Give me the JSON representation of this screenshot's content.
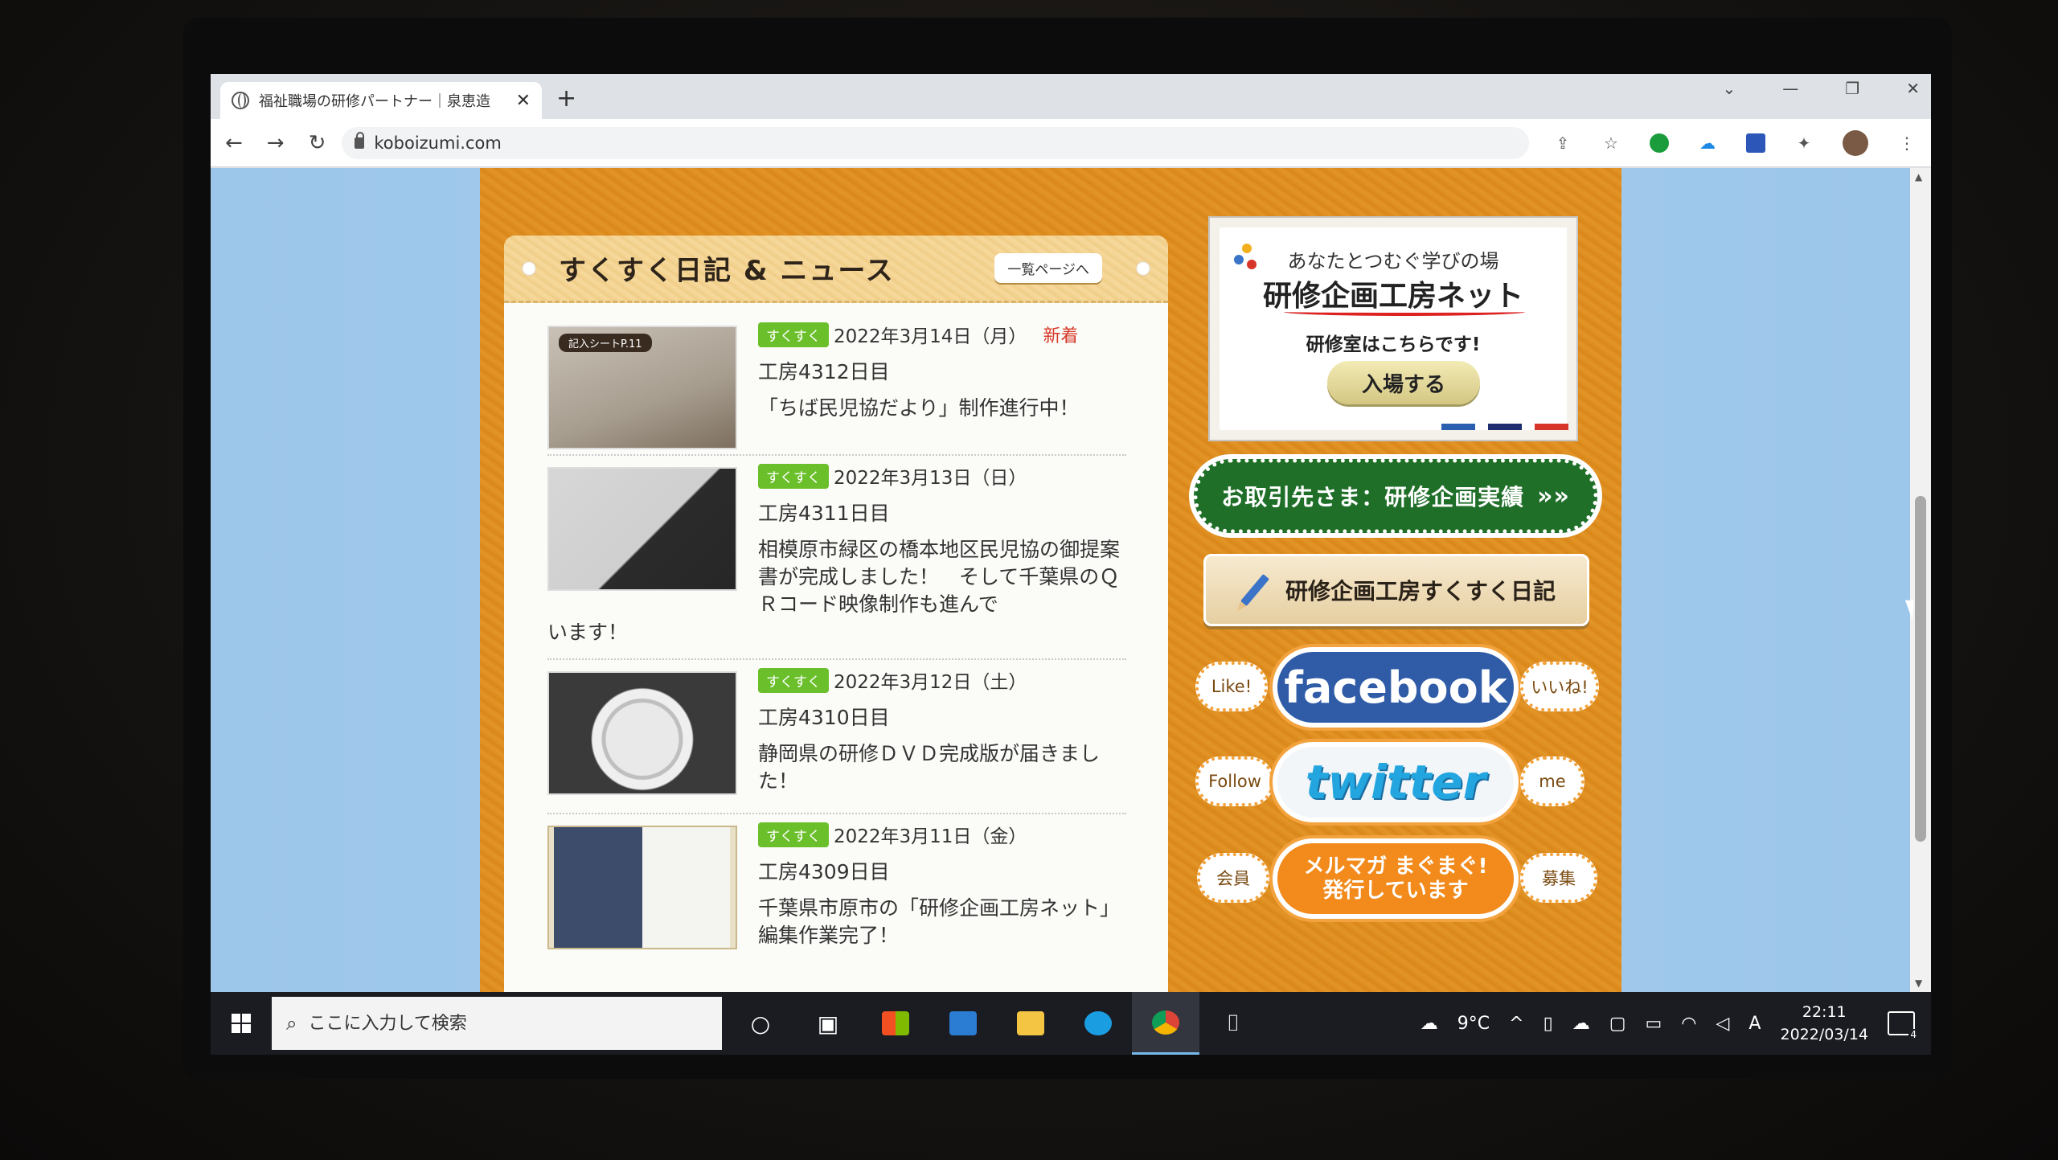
{
  "browser": {
    "tab_title": "福祉職場の研修パートナー｜泉恵造",
    "tab_close": "✕",
    "new_tab": "+",
    "url": "koboizumi.com",
    "window_controls": [
      "⌄",
      "—",
      "❐",
      "✕"
    ]
  },
  "news": {
    "title": "すくすく日記 & ニュース",
    "more_button": "一覧ページへ",
    "thumb_tag": "記入シートP.11",
    "items": [
      {
        "badge": "すくすく",
        "date": "2022年3月14日（月）",
        "new_label": "新着",
        "count": "工房4312日目",
        "desc": "「ちば民児協だより」制作進行中！",
        "desc_overflow": ""
      },
      {
        "badge": "すくすく",
        "date": "2022年3月13日（日）",
        "new_label": "",
        "count": "工房4311日目",
        "desc": "相模原市緑区の橋本地区民児協の御提案書が完成しました！　そして千葉県のＱＲコード映像制作も進んで",
        "desc_overflow": "います！"
      },
      {
        "badge": "すくすく",
        "date": "2022年3月12日（土）",
        "new_label": "",
        "count": "工房4310日目",
        "desc": "静岡県の研修ＤＶＤ完成版が届きました！",
        "desc_overflow": ""
      },
      {
        "badge": "すくすく",
        "date": "2022年3月11日（金）",
        "new_label": "",
        "count": "工房4309日目",
        "desc": "千葉県市原市の「研修企画工房ネット」編集作業完了！",
        "desc_overflow": ""
      }
    ]
  },
  "sidebar": {
    "banner": {
      "subtitle": "あなたとつむぐ学びの場",
      "title": "研修企画工房ネット",
      "room_text": "研修室はこちらです!",
      "enter_button": "入場する"
    },
    "clients_button": "お取引先さま：研修企画実績",
    "clients_arrows": "»»",
    "diary_button": "研修企画工房すくすく日記",
    "facebook": {
      "left": "Like!",
      "label": "facebook",
      "right": "いいね!"
    },
    "twitter": {
      "left": "Follow",
      "label": "twitter",
      "right": "me"
    },
    "mailmag": {
      "left": "会員",
      "line1": "メルマガ まぐまぐ!",
      "line2": "発行しています",
      "right": "募集"
    }
  },
  "taskbar": {
    "search_placeholder": "ここに入力して検索",
    "weather": "9°C",
    "ime": "A",
    "time": "22:11",
    "date": "2022/03/14",
    "notifications": "4"
  },
  "colors": {
    "orange_bg": "#dc8a1c",
    "badge_green": "#6abf2a",
    "new_red": "#d73a2a",
    "clients_green": "#1f6f29",
    "facebook_blue": "#2f5ba7",
    "twitter_blue": "#23a6df"
  }
}
